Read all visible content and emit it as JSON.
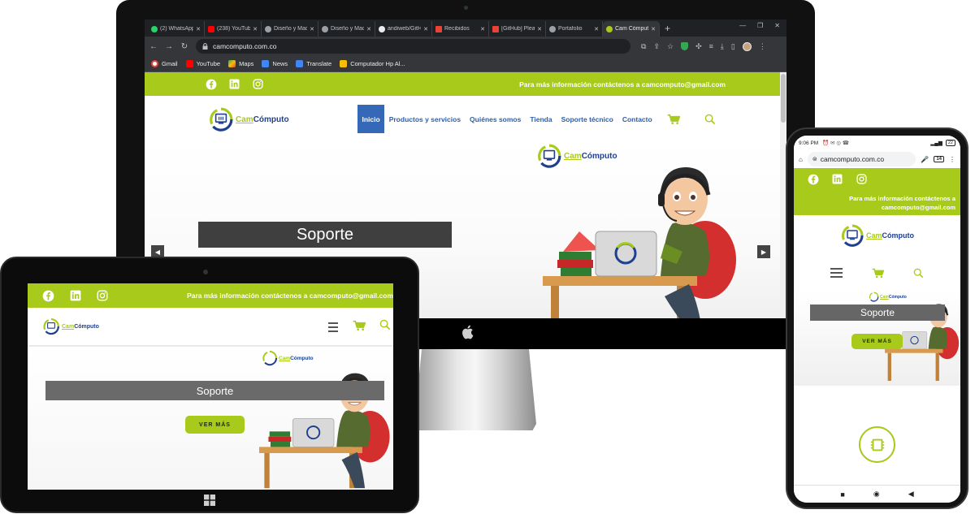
{
  "browser": {
    "tabs": [
      {
        "label": "(2) WhatsApp",
        "color": "#25d366"
      },
      {
        "label": "(238) YouTube",
        "color": "#ff0000"
      },
      {
        "label": "Diseño y Maquetación",
        "color": "#9aa0a6"
      },
      {
        "label": "Diseño y Maquetación",
        "color": "#9aa0a6"
      },
      {
        "label": "andiweb/GitHub",
        "color": "#e8eaed"
      },
      {
        "label": "Recibidos",
        "color": "#ea4335"
      },
      {
        "label": "[GitHub] Please",
        "color": "#ea4335"
      },
      {
        "label": "Portafolio",
        "color": "#9aa0a6"
      },
      {
        "label": "Cam Cómputo",
        "color": "#a8ca1a"
      }
    ],
    "new_tab": "+",
    "url": "camcomputo.com.co",
    "bookmarks": [
      {
        "label": "Gmail",
        "color": "#ea4335"
      },
      {
        "label": "YouTube",
        "color": "#ff0000"
      },
      {
        "label": "Maps",
        "color": "#34a853"
      },
      {
        "label": "News",
        "color": "#4285f4"
      },
      {
        "label": "Translate",
        "color": "#4285f4"
      },
      {
        "label": "Computador Hp Al...",
        "color": "#fbbc04"
      }
    ]
  },
  "site": {
    "contact_text": "Para más información contáctenos a camcomputo@gmail.com",
    "contact_line1": "Para más información contáctenos a",
    "contact_line2": "camcomputo@gmail.com",
    "logo_cam": "Cam",
    "logo_rest": "Cómputo",
    "menu": [
      "Inicio",
      "Productos y servicios",
      "Quiénes somos",
      "Tienda",
      "Soporte técnico",
      "Contacto"
    ],
    "hero_title": "Soporte",
    "cta": "VER MÁS"
  },
  "phone": {
    "time": "9:06 PM",
    "battery": "22",
    "url": "camcomputo.com.co",
    "tab_count": "14"
  },
  "colors": {
    "brand_green": "#a8ca1a",
    "brand_blue": "#1f3f8f",
    "menu_blue": "#2e5ea8",
    "active_menu": "#3569b8"
  },
  "icons": [
    "facebook-icon",
    "linkedin-icon",
    "instagram-icon",
    "cart-icon",
    "search-icon",
    "hamburger-icon",
    "chip-icon",
    "apple-icon",
    "windows-icon"
  ]
}
